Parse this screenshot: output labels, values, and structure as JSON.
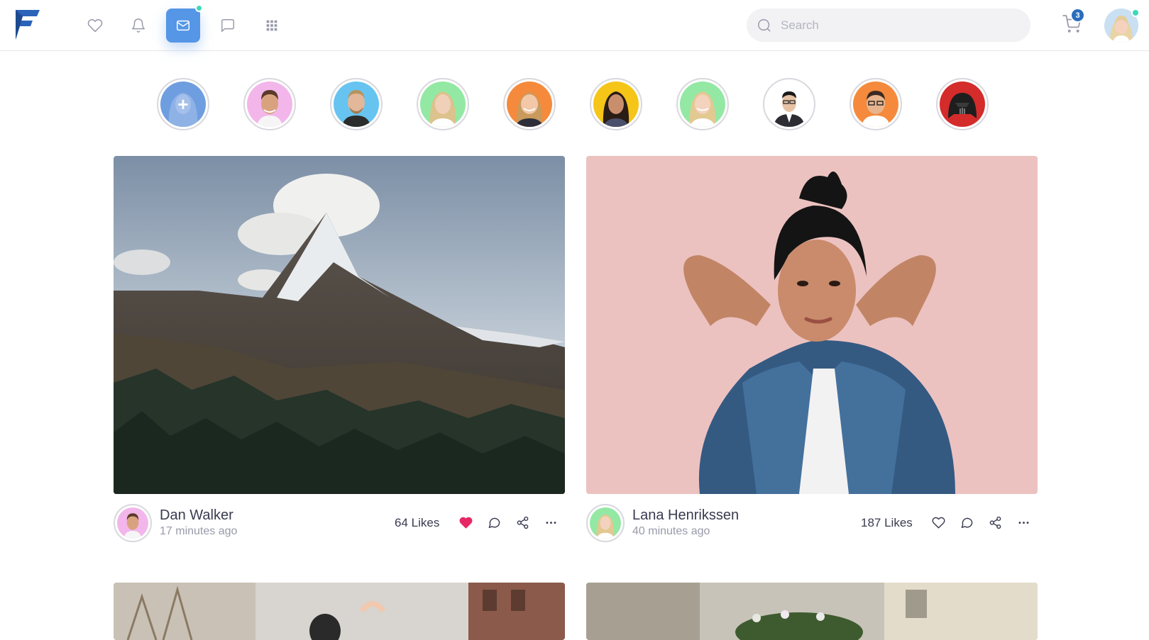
{
  "navbar": {
    "logo_alt": "Friendkit",
    "icons": [
      "heart-icon",
      "bell-icon",
      "envelope-icon",
      "chat-icon",
      "apps-grid-icon"
    ],
    "search_placeholder": "Search",
    "cart_count": "3",
    "accent": "#5596e6",
    "online_color": "#3dd8b9"
  },
  "stories": [
    {
      "label": "add-story"
    },
    {
      "label": "story-2"
    },
    {
      "label": "story-3"
    },
    {
      "label": "story-4"
    },
    {
      "label": "story-5"
    },
    {
      "label": "story-6"
    },
    {
      "label": "story-7"
    },
    {
      "label": "story-8"
    },
    {
      "label": "story-9"
    },
    {
      "label": "story-10"
    }
  ],
  "posts": [
    {
      "author": "Dan Walker",
      "time": "17 minutes ago",
      "likes": "64 Likes",
      "liked": true,
      "image": "mountain-landscape"
    },
    {
      "author": "Lana Henrikssen",
      "time": "40 minutes ago",
      "likes": "187 Likes",
      "liked": false,
      "image": "woman-denim-jacket-pink-wall"
    }
  ]
}
